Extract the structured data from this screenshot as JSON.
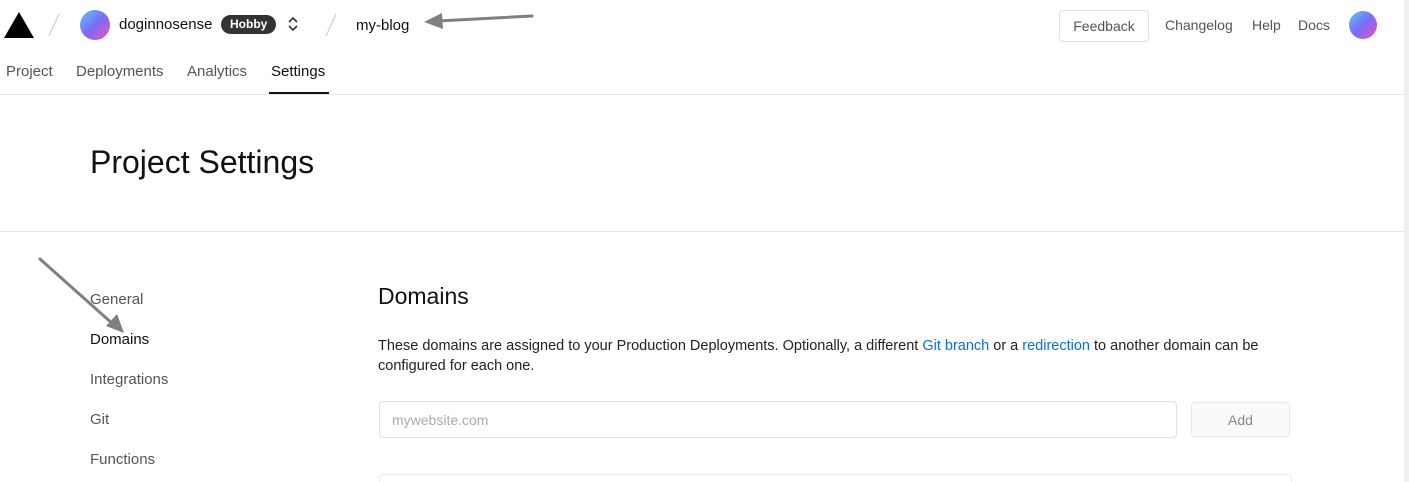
{
  "topbar": {
    "team_name": "doginnosense",
    "plan_badge": "Hobby",
    "project_name": "my-blog",
    "feedback_label": "Feedback",
    "links": [
      "Changelog",
      "Help",
      "Docs"
    ]
  },
  "tabs": [
    {
      "label": "Project"
    },
    {
      "label": "Deployments"
    },
    {
      "label": "Analytics"
    },
    {
      "label": "Settings",
      "active": true
    }
  ],
  "page": {
    "title": "Project Settings"
  },
  "sidebar": {
    "items": [
      {
        "label": "General"
      },
      {
        "label": "Domains",
        "active": true
      },
      {
        "label": "Integrations"
      },
      {
        "label": "Git"
      },
      {
        "label": "Functions"
      }
    ]
  },
  "domains": {
    "title": "Domains",
    "description_before": "These domains are assigned to your Production Deployments. Optionally, a different ",
    "git_branch_link": "Git branch",
    "description_middle": " or a ",
    "redirection_link": "redirection",
    "description_after": " to another domain can be configured for each one.",
    "input_value": "",
    "input_placeholder": "mywebsite.com",
    "add_label": "Add"
  },
  "icons": {
    "logo": "vercel-triangle-icon",
    "switcher": "chevron-up-down-icon",
    "annotation": "arrow-icon"
  },
  "colors": {
    "link": "#0a6fe8",
    "badge_bg": "#333333",
    "avatar_gradient": [
      "#5ec8f5",
      "#7b6cf6",
      "#f04fc1"
    ],
    "annotation_arrow": "#808080"
  }
}
